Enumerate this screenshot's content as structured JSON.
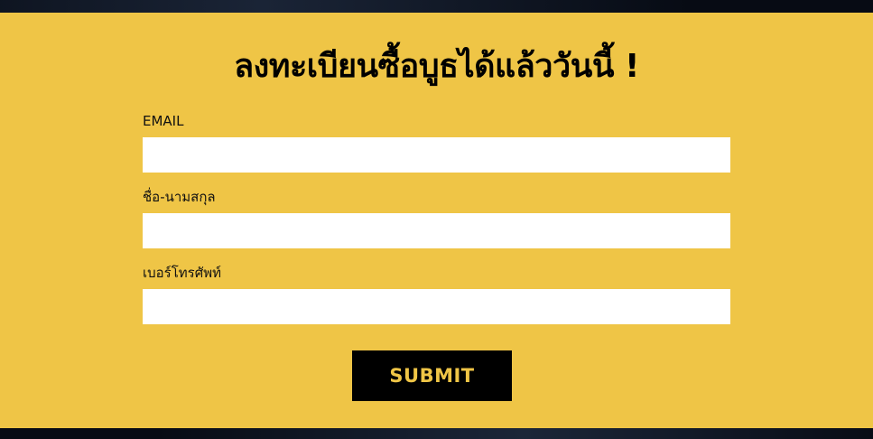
{
  "colors": {
    "panel_background": "#EFC546",
    "button_background": "#000000",
    "button_text": "#EFC546",
    "input_background": "#FFFFFF",
    "page_background": "#0b1220"
  },
  "form": {
    "title": "ลงทะเบียนซื้อบูธได้แล้ววันนี้ !",
    "fields": [
      {
        "label": "EMAIL",
        "value": "",
        "placeholder": ""
      },
      {
        "label": "ชื่อ-นามสกุล",
        "value": "",
        "placeholder": ""
      },
      {
        "label": "เบอร์โทรศัพท์",
        "value": "",
        "placeholder": ""
      }
    ],
    "submit_label": "SUBMIT"
  }
}
